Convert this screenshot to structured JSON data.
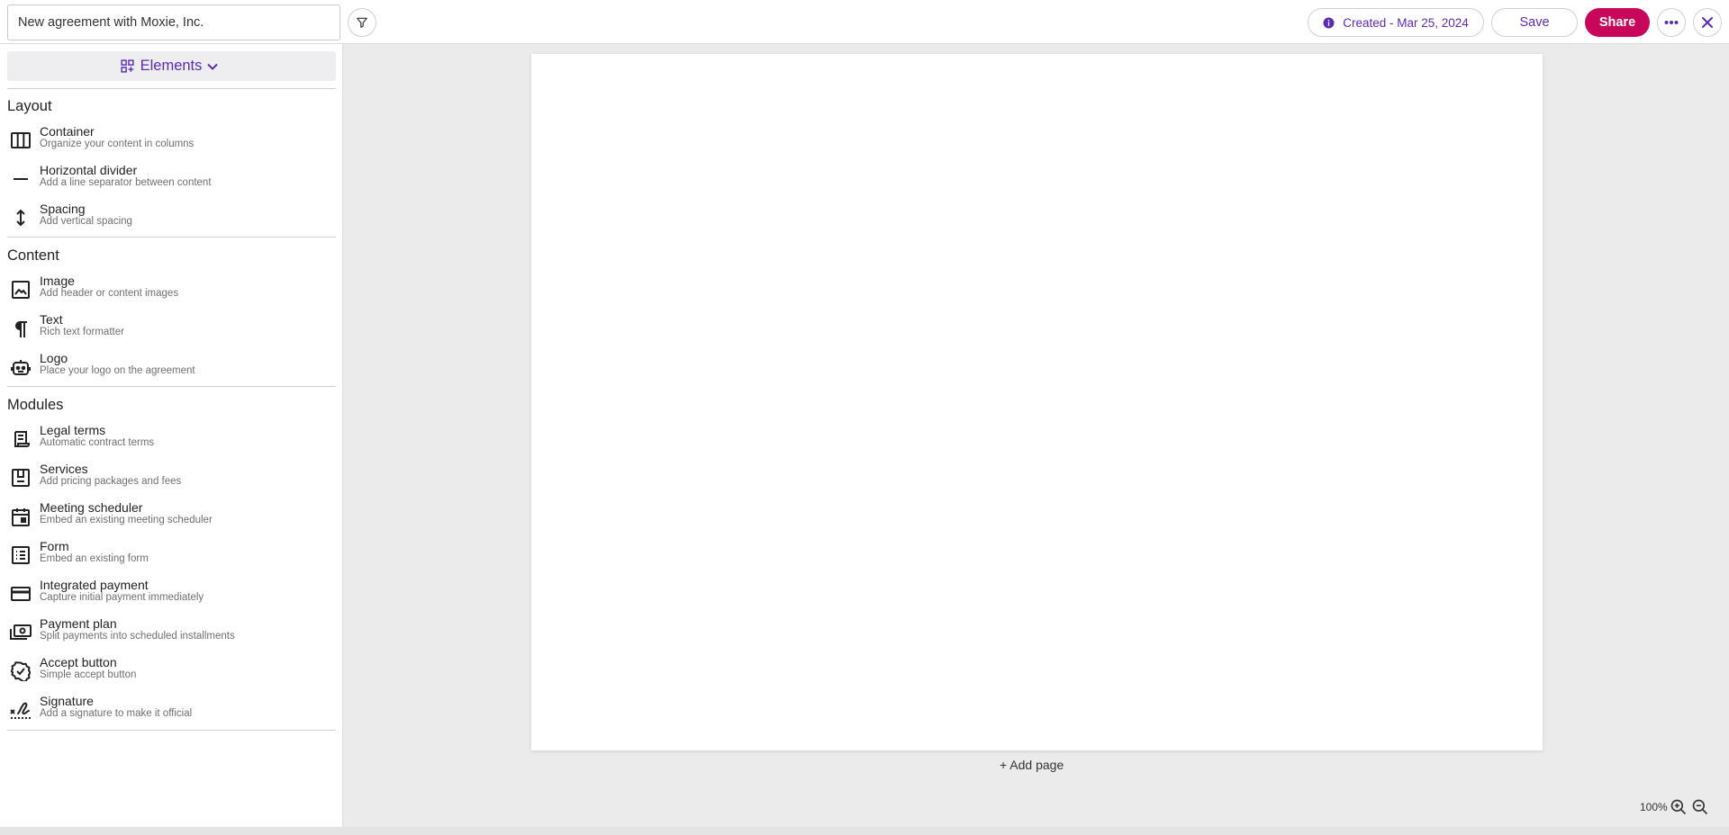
{
  "header": {
    "document_title": "New agreement with Moxie, Inc.",
    "filter_icon": "filter-icon",
    "created_label": "Created - Mar 25, 2024",
    "info_icon": "info-icon",
    "save_label": "Save",
    "share_label": "Share",
    "more_icon": "more-horizontal-icon",
    "close_icon": "close-icon"
  },
  "sidebar": {
    "elements_label": "Elements",
    "sections": [
      {
        "title": "Layout",
        "items": [
          {
            "label": "Container",
            "desc": "Organize your content in columns",
            "icon": "columns-icon"
          },
          {
            "label": "Horizontal divider",
            "desc": "Add a line separator between content",
            "icon": "horizontal-line-icon"
          },
          {
            "label": "Spacing",
            "desc": "Add vertical spacing",
            "icon": "vertical-arrows-icon"
          }
        ]
      },
      {
        "title": "Content",
        "items": [
          {
            "label": "Image",
            "desc": "Add header or content images",
            "icon": "image-icon"
          },
          {
            "label": "Text",
            "desc": "Rich text formatter",
            "icon": "pilcrow-icon"
          },
          {
            "label": "Logo",
            "desc": "Place your logo on the agreement",
            "icon": "robot-icon"
          }
        ]
      },
      {
        "title": "Modules",
        "items": [
          {
            "label": "Legal terms",
            "desc": "Automatic contract terms",
            "icon": "scroll-icon"
          },
          {
            "label": "Services",
            "desc": "Add pricing packages and fees",
            "icon": "box-icon"
          },
          {
            "label": "Meeting scheduler",
            "desc": "Embed an existing meeting scheduler",
            "icon": "calendar-icon"
          },
          {
            "label": "Form",
            "desc": "Embed an existing form",
            "icon": "list-form-icon"
          },
          {
            "label": "Integrated payment",
            "desc": "Capture initial payment immediately",
            "icon": "credit-card-icon"
          },
          {
            "label": "Payment plan",
            "desc": "Split payments into scheduled installments",
            "icon": "money-stack-icon"
          },
          {
            "label": "Accept button",
            "desc": "Simple accept button",
            "icon": "check-badge-icon"
          },
          {
            "label": "Signature",
            "desc": "Add a signature to make it official",
            "icon": "signature-icon"
          }
        ]
      }
    ]
  },
  "canvas": {
    "add_page_label": "+ Add page",
    "zoom_level": "100%"
  },
  "colors": {
    "accent": "#5b2bb5",
    "share": "#c8075a",
    "workspace": "#ebebeb"
  }
}
